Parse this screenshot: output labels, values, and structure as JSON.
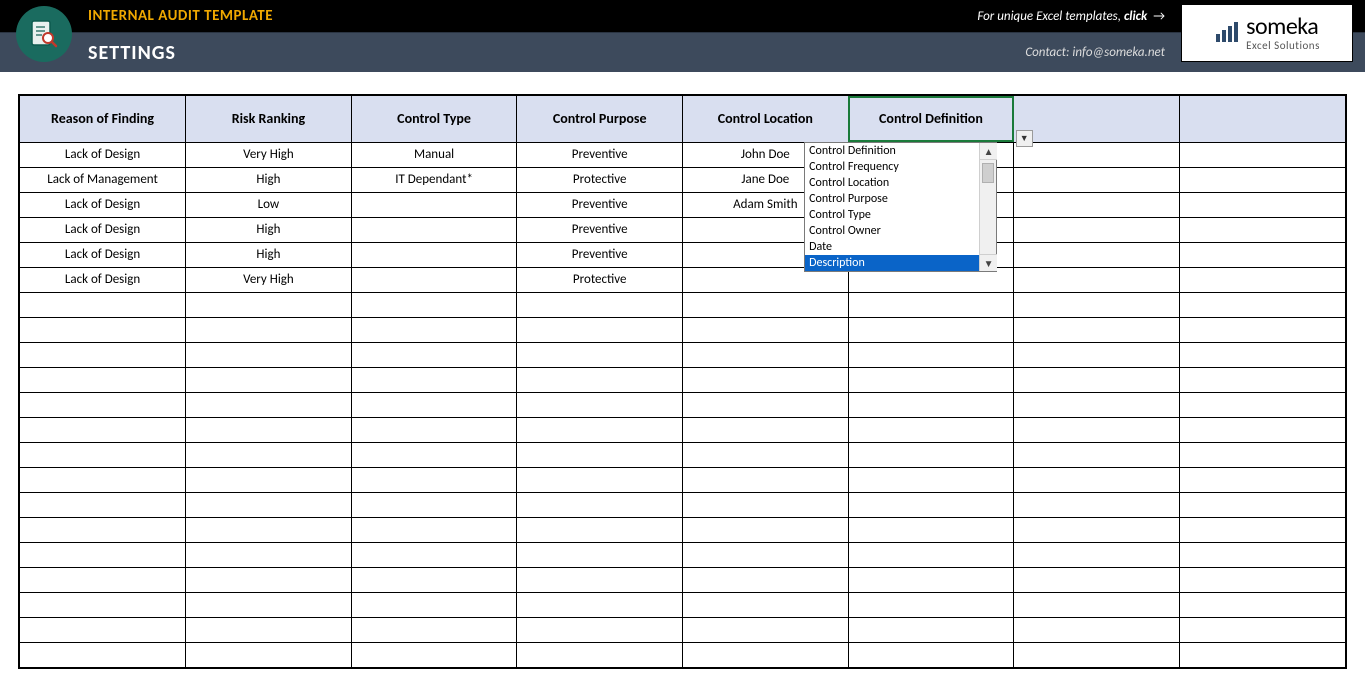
{
  "header": {
    "template_title": "INTERNAL AUDIT TEMPLATE",
    "settings_label": "SETTINGS",
    "promo_text": "For unique Excel templates, ",
    "promo_cta": "click",
    "promo_arrow": "→",
    "contact_text": "Contact: info@someka.net",
    "logo_brand": "someka",
    "logo_sub": "Excel Solutions"
  },
  "columns": [
    "Reason of Finding",
    "Risk Ranking",
    "Control Type",
    "Control Purpose",
    "Control Location",
    "Control Definition",
    "",
    ""
  ],
  "selected_column_index": 5,
  "rows": [
    [
      "Lack of Design",
      "Very High",
      "Manual",
      "Preventive",
      "John Doe",
      "",
      "",
      ""
    ],
    [
      "Lack of Management",
      "High",
      "IT Dependant*",
      "Protective",
      "Jane Doe",
      "",
      "",
      ""
    ],
    [
      "Lack of Design",
      "Low",
      "",
      "Preventive",
      "Adam Smith",
      "",
      "",
      ""
    ],
    [
      "Lack of Design",
      "High",
      "",
      "Preventive",
      "",
      "",
      "",
      ""
    ],
    [
      "Lack of Design",
      "High",
      "",
      "Preventive",
      "",
      "",
      "",
      ""
    ],
    [
      "Lack of Design",
      "Very High",
      "",
      "Protective",
      "",
      "",
      "",
      ""
    ],
    [
      "",
      "",
      "",
      "",
      "",
      "",
      "",
      ""
    ],
    [
      "",
      "",
      "",
      "",
      "",
      "",
      "",
      ""
    ],
    [
      "",
      "",
      "",
      "",
      "",
      "",
      "",
      ""
    ],
    [
      "",
      "",
      "",
      "",
      "",
      "",
      "",
      ""
    ],
    [
      "",
      "",
      "",
      "",
      "",
      "",
      "",
      ""
    ],
    [
      "",
      "",
      "",
      "",
      "",
      "",
      "",
      ""
    ],
    [
      "",
      "",
      "",
      "",
      "",
      "",
      "",
      ""
    ],
    [
      "",
      "",
      "",
      "",
      "",
      "",
      "",
      ""
    ],
    [
      "",
      "",
      "",
      "",
      "",
      "",
      "",
      ""
    ],
    [
      "",
      "",
      "",
      "",
      "",
      "",
      "",
      ""
    ],
    [
      "",
      "",
      "",
      "",
      "",
      "",
      "",
      ""
    ],
    [
      "",
      "",
      "",
      "",
      "",
      "",
      "",
      ""
    ],
    [
      "",
      "",
      "",
      "",
      "",
      "",
      "",
      ""
    ],
    [
      "",
      "",
      "",
      "",
      "",
      "",
      "",
      ""
    ],
    [
      "",
      "",
      "",
      "",
      "",
      "",
      "",
      ""
    ]
  ],
  "dropdown": {
    "options": [
      "Control Definition",
      "Control Frequency",
      "Control Location",
      "Control Purpose",
      "Control Type",
      "Control Owner",
      "Date",
      "Description"
    ],
    "selected_index": 7
  }
}
